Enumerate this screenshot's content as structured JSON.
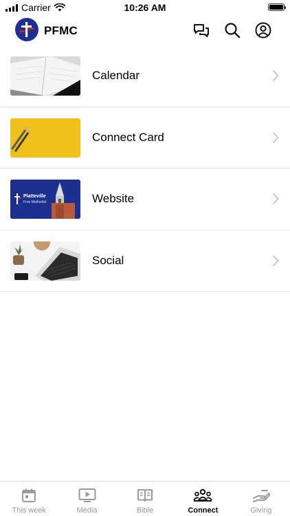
{
  "status_bar": {
    "carrier": "Carrier",
    "time": "10:26 AM"
  },
  "header": {
    "title": "PFMC",
    "icons": [
      "chat-icon",
      "search-icon",
      "account-icon"
    ]
  },
  "items": [
    {
      "label": "Calendar",
      "thumb": "calendar-photo"
    },
    {
      "label": "Connect Card",
      "thumb": "pencils-on-yellow-photo"
    },
    {
      "label": "Website",
      "thumb": "church-website-banner",
      "thumb_text": [
        "Platteville",
        "Free Methodist"
      ]
    },
    {
      "label": "Social",
      "thumb": "laptop-desk-photo"
    }
  ],
  "tabs": [
    {
      "label": "This week",
      "icon": "calendar-icon",
      "active": false
    },
    {
      "label": "Media",
      "icon": "play-icon",
      "active": false
    },
    {
      "label": "Bible",
      "icon": "book-icon",
      "active": false
    },
    {
      "label": "Connect",
      "icon": "people-icon",
      "active": true
    },
    {
      "label": "Giving",
      "icon": "hand-icon",
      "active": false
    }
  ],
  "colors": {
    "brand_blue": "#1d2f8f",
    "accent_red": "#c8262b",
    "yellow": "#f2c01b"
  }
}
